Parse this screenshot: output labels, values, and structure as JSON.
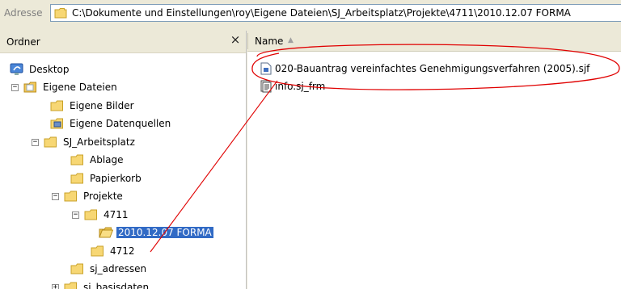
{
  "address": {
    "label": "Adresse",
    "path": "C:\\Dokumente und Einstellungen\\roy\\Eigene Dateien\\SJ_Arbeitsplatz\\Projekte\\4711\\2010.12.07 FORMA"
  },
  "folder_pane": {
    "title": "Ordner",
    "close_label": "×",
    "tree": [
      {
        "label": "Desktop",
        "expander": null,
        "icon": "desktop-icon"
      },
      {
        "label": "Eigene Dateien",
        "expander": "−",
        "icon": "my-documents-icon"
      },
      {
        "label": "Eigene Bilder",
        "expander": null,
        "icon": "folder-icon"
      },
      {
        "label": "Eigene Datenquellen",
        "expander": null,
        "icon": "data-source-folder-icon"
      },
      {
        "label": "SJ_Arbeitsplatz",
        "expander": "−",
        "icon": "folder-icon"
      },
      {
        "label": "Ablage",
        "expander": null,
        "icon": "folder-icon"
      },
      {
        "label": "Papierkorb",
        "expander": null,
        "icon": "folder-icon"
      },
      {
        "label": "Projekte",
        "expander": "−",
        "icon": "folder-icon"
      },
      {
        "label": "4711",
        "expander": "−",
        "icon": "folder-icon"
      },
      {
        "label": "2010.12.07 FORMA",
        "expander": null,
        "icon": "folder-open-icon",
        "selected": true
      },
      {
        "label": "4712",
        "expander": null,
        "icon": "folder-icon"
      },
      {
        "label": "sj_adressen",
        "expander": null,
        "icon": "folder-icon"
      },
      {
        "label": "sj_basisdaten",
        "expander": "+",
        "icon": "folder-icon"
      }
    ]
  },
  "file_pane": {
    "column_name": "Name",
    "sort_indicator": "▲",
    "files": [
      {
        "name": "020-Bauantrag vereinfachtes Genehmigungsverfahren (2005).sjf",
        "icon": "sjf-file-icon"
      },
      {
        "name": "info.sj_frm",
        "icon": "frm-file-icon"
      }
    ]
  },
  "annotation": {
    "color": "#e00000"
  }
}
